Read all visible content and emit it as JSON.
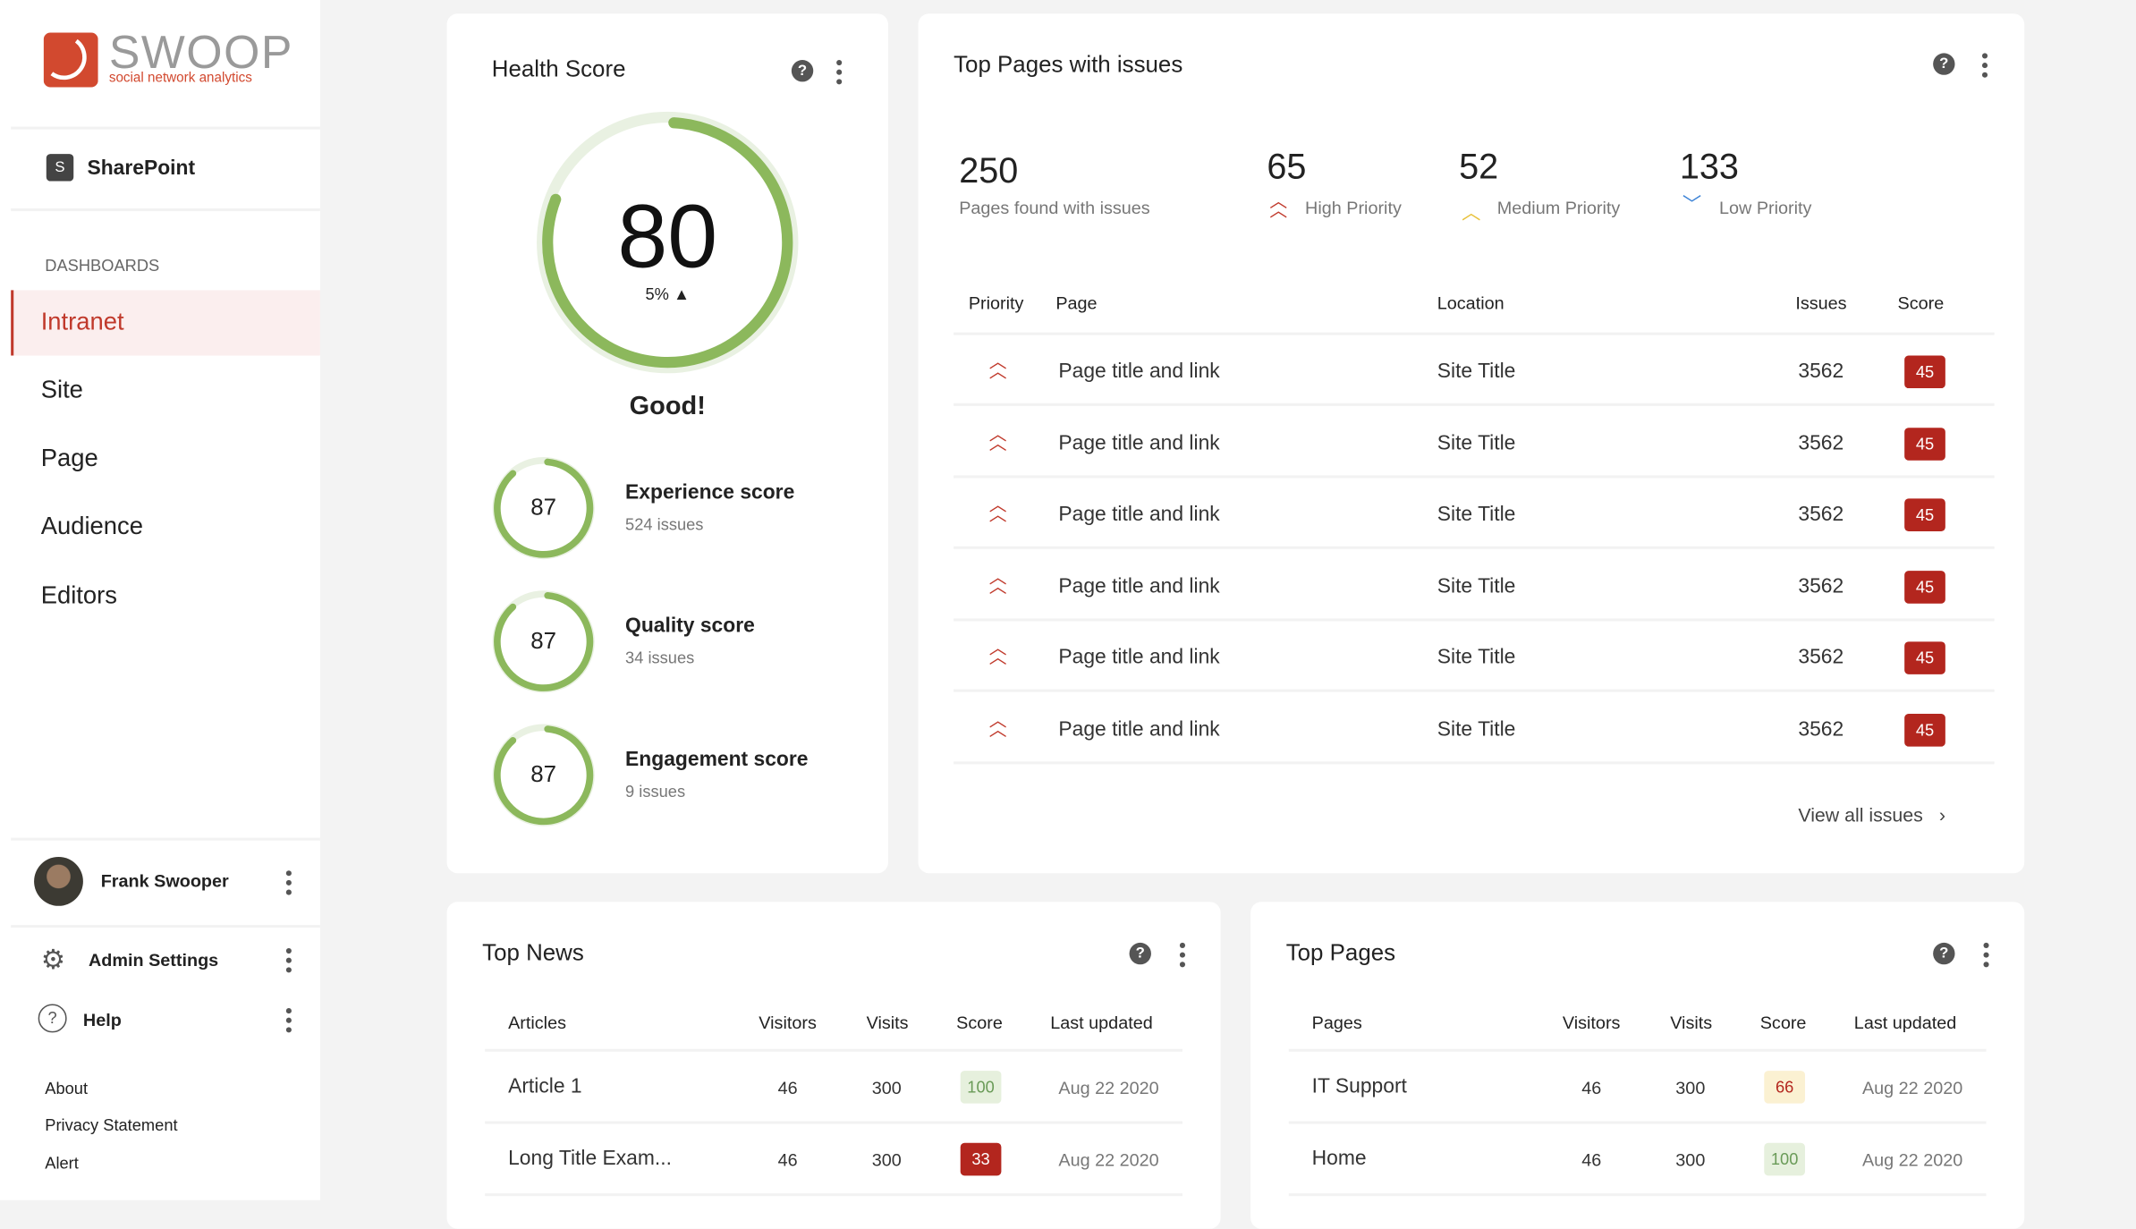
{
  "brand": {
    "name": "SWOOP",
    "tagline": "social network analytics",
    "color": "#d2492f"
  },
  "sidebar": {
    "platform": "SharePoint",
    "section_label": "DASHBOARDS",
    "items": [
      {
        "label": "Intranet",
        "active": true
      },
      {
        "label": "Site"
      },
      {
        "label": "Page"
      },
      {
        "label": "Audience"
      },
      {
        "label": "Editors"
      }
    ],
    "user": "Frank Swooper",
    "admin": "Admin Settings",
    "help": "Help",
    "links": [
      "About",
      "Privacy Statement",
      "Alert"
    ]
  },
  "health": {
    "title": "Health Score",
    "score": 80,
    "score_text": "80",
    "change": "5%",
    "status": "Good!",
    "subscores": [
      {
        "value": 87,
        "value_text": "87",
        "label": "Experience score",
        "issues": "524 issues"
      },
      {
        "value": 87,
        "value_text": "87",
        "label": "Quality score",
        "issues": "34 issues"
      },
      {
        "value": 87,
        "value_text": "87",
        "label": "Engagement score",
        "issues": "9 issues"
      }
    ],
    "ring_color": "#8cb85c",
    "ring_track": "#e9f1e2"
  },
  "issues": {
    "title": "Top Pages with issues",
    "stats": [
      {
        "value": "250",
        "label": "Pages found with issues"
      },
      {
        "value": "65",
        "label": "High Priority",
        "icon": "double-chevron-up-icon",
        "color": "#c0392b"
      },
      {
        "value": "52",
        "label": "Medium Priority",
        "icon": "chevron-up-icon",
        "color": "#e8c13a"
      },
      {
        "value": "133",
        "label": "Low Priority",
        "icon": "chevron-down-icon",
        "color": "#3b82d6"
      }
    ],
    "columns": [
      "Priority",
      "Page",
      "Location",
      "Issues",
      "Score"
    ],
    "rows": [
      {
        "page": "Page title and link",
        "location": "Site Title",
        "issues": "3562",
        "score": "45"
      },
      {
        "page": "Page title and link",
        "location": "Site Title",
        "issues": "3562",
        "score": "45"
      },
      {
        "page": "Page title and link",
        "location": "Site Title",
        "issues": "3562",
        "score": "45"
      },
      {
        "page": "Page title and link",
        "location": "Site Title",
        "issues": "3562",
        "score": "45"
      },
      {
        "page": "Page title and link",
        "location": "Site Title",
        "issues": "3562",
        "score": "45"
      },
      {
        "page": "Page title and link",
        "location": "Site Title",
        "issues": "3562",
        "score": "45"
      }
    ],
    "view_all": "View all issues"
  },
  "top_news": {
    "title": "Top News",
    "columns": [
      "Articles",
      "Visitors",
      "Visits",
      "Score",
      "Last updated"
    ],
    "rows": [
      {
        "name": "Article 1",
        "visitors": "46",
        "visits": "300",
        "score": "100",
        "score_level": "green",
        "updated": "Aug 22 2020"
      },
      {
        "name": "Long Title Exam...",
        "visitors": "46",
        "visits": "300",
        "score": "33",
        "score_level": "red",
        "updated": "Aug 22 2020"
      }
    ]
  },
  "top_pages": {
    "title": "Top Pages",
    "columns": [
      "Pages",
      "Visitors",
      "Visits",
      "Score",
      "Last updated"
    ],
    "rows": [
      {
        "name": "IT Support",
        "visitors": "46",
        "visits": "300",
        "score": "66",
        "score_level": "yellow",
        "updated": "Aug 22 2020"
      },
      {
        "name": "Home",
        "visitors": "46",
        "visits": "300",
        "score": "100",
        "score_level": "green",
        "updated": "Aug 22 2020"
      }
    ]
  }
}
